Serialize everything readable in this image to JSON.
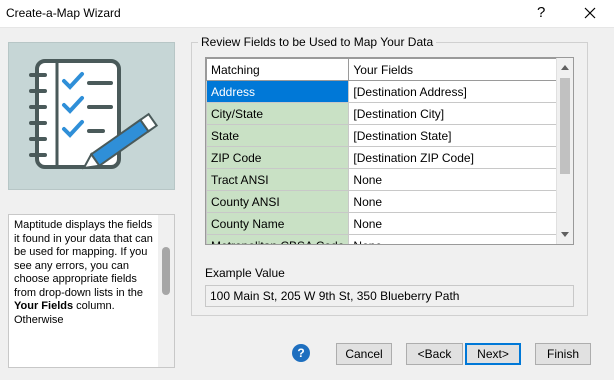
{
  "window": {
    "title": "Create-a-Map Wizard",
    "help_glyph": "?",
    "close_icon": "close-icon"
  },
  "left_panel": {
    "illustration_icon": "checklist-pencil-icon",
    "description_parts": [
      "Maptitude displays the fields it found in your data that can be used for mapping. If you see any errors, you can choose appropriate fields from drop-down lists in the ",
      "Your Fields",
      " column. Otherwise"
    ]
  },
  "group": {
    "title": "Review Fields to be Used to Map Your Data"
  },
  "grid": {
    "columns": [
      "Matching",
      "Your Fields"
    ],
    "selected_row": 0,
    "rows": [
      {
        "matching": "Address",
        "field": "[Destination Address]"
      },
      {
        "matching": "City/State",
        "field": "[Destination City]"
      },
      {
        "matching": "State",
        "field": "[Destination State]"
      },
      {
        "matching": "ZIP Code",
        "field": "[Destination ZIP Code]"
      },
      {
        "matching": "Tract ANSI",
        "field": "None"
      },
      {
        "matching": "County ANSI",
        "field": "None"
      },
      {
        "matching": "County Name",
        "field": "None"
      },
      {
        "matching": "Metropolitan CBSA Code",
        "field": "None"
      }
    ]
  },
  "example": {
    "label": "Example Value",
    "value": "100 Main St, 205 W 9th St, 350 Blueberry Path"
  },
  "footer": {
    "help_glyph": "?",
    "cancel": "Cancel",
    "back": "<Back",
    "next": "Next>",
    "finish": "Finish"
  },
  "colors": {
    "matching_cell": "#c9e1c5",
    "selection": "#0078d7",
    "illustration_bg": "#c6d6d6",
    "help_icon": "#1e6fbf"
  }
}
